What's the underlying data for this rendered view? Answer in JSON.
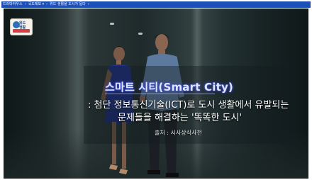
{
  "breadcrumb": {
    "items": [
      "드라마하우스",
      "국도제보 ▾",
      "위드 생활을 도시가 됩다"
    ]
  },
  "video": {
    "logo_text": "위드\n생활"
  },
  "caption": {
    "title": "스마트 시티(Smart City)",
    "definition_line1": ": 첨단 정보통신기술(ICT)로 도시 생활에서 유발되는",
    "definition_line2": "문제들을 해결하는 '똑똑한 도시'",
    "source": "출처 : 시사상식사전"
  },
  "colors": {
    "topbar": "#1c4fb8",
    "title_glow": "#3a46d6"
  }
}
